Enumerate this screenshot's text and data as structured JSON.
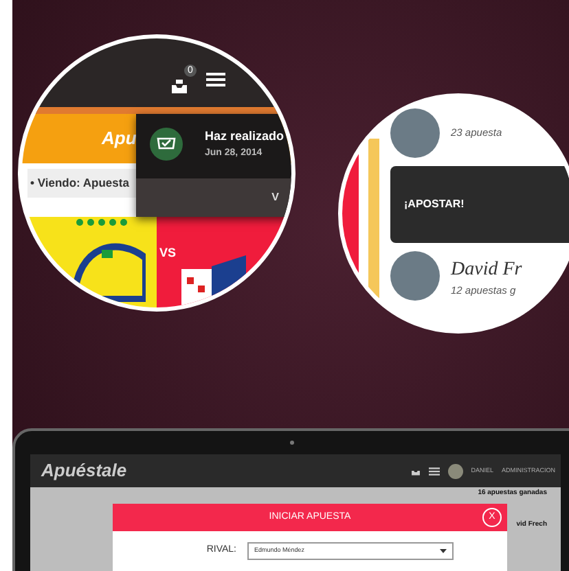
{
  "zoom_left": {
    "notification_count": "0",
    "banner_title": "Apu",
    "viewing_text": "• Viendo: Apuesta",
    "popover": {
      "title": "Haz realizado",
      "date": "Jun 28, 2014",
      "footer": "V"
    },
    "match_vs": "VS"
  },
  "zoom_right": {
    "rows": [
      {
        "kind": "user",
        "subtitle": "23 apuesta"
      },
      {
        "kind": "action",
        "label": "¡APOSTAR!"
      },
      {
        "kind": "user",
        "name": "David Fr",
        "subtitle": "12 apuestas g"
      }
    ]
  },
  "laptop": {
    "logo": "Apuéstale",
    "user": "DANIEL",
    "menu": "ADMINISTRACION",
    "side_texts": [
      "16 apuestas ganadas",
      "vid Frech"
    ],
    "modal": {
      "title": "INICIAR APUESTA",
      "close": "X",
      "fields": [
        {
          "label": "RIVAL:",
          "value": "Edmundo Méndez"
        }
      ]
    }
  }
}
